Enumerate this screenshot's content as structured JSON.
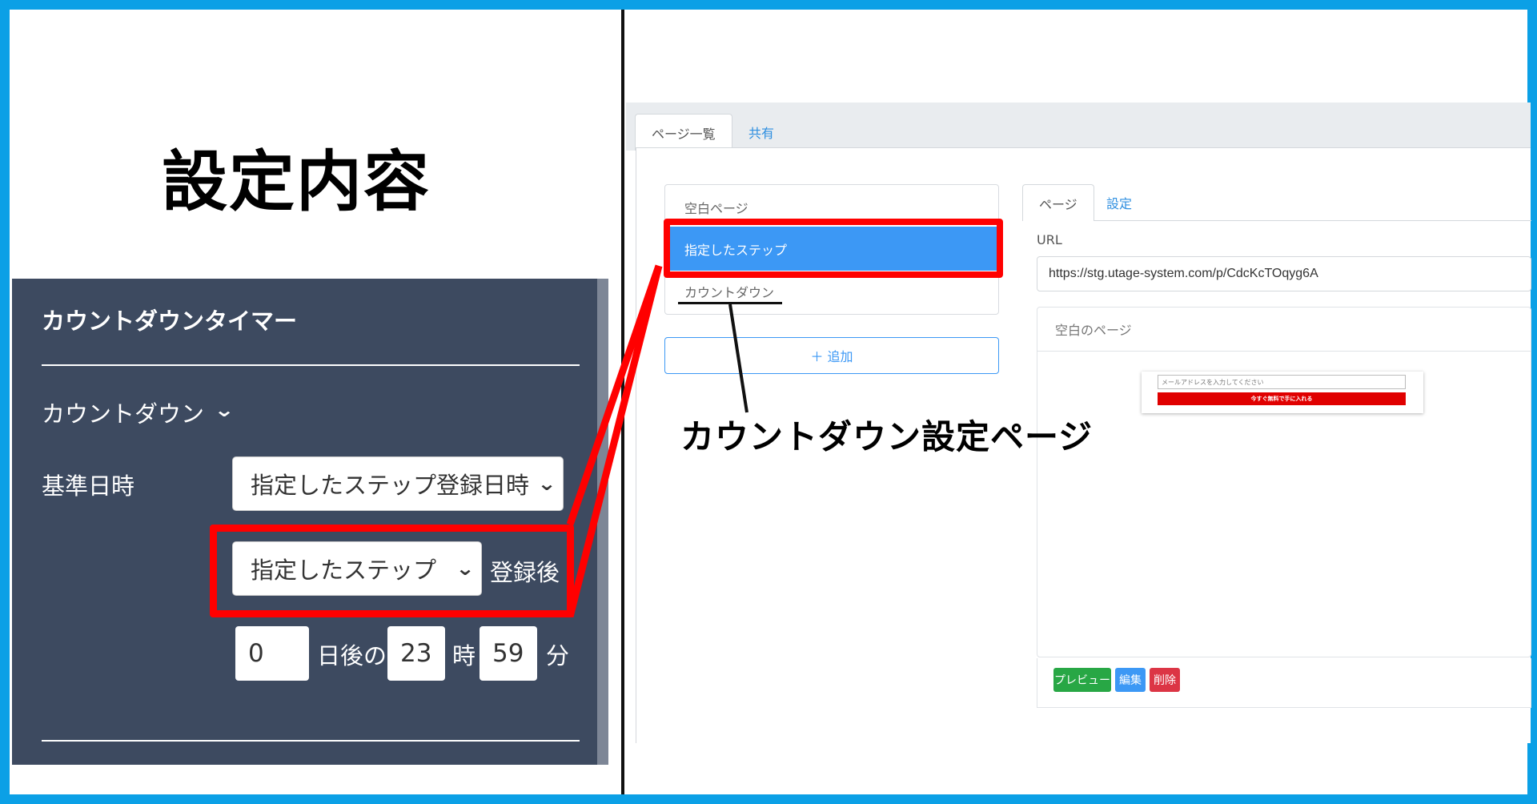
{
  "left": {
    "heading": "設定内容",
    "panel_title": "カウントダウンタイマー",
    "countdown_label": "カウントダウン",
    "base_datetime_label": "基準日時",
    "base_select_value": "指定したステップ登録日時",
    "step_select_value": "指定したステップ",
    "after_registration": "登録後",
    "days_value": "0",
    "days_suffix": "日後の",
    "hours_value": "23",
    "hours_suffix": "時",
    "minutes_value": "59",
    "minutes_suffix": "分"
  },
  "app": {
    "top_tabs": [
      "ページ一覧",
      "共有"
    ],
    "page_list": [
      "空白ページ",
      "指定したステップ",
      "カウントダウン"
    ],
    "add_button": "＋ 追加",
    "page_tabs": [
      "ページ",
      "設定"
    ],
    "url_label": "URL",
    "url_value": "https://stg.utage-system.com/p/CdcKcTOqyg6A",
    "preview_title": "空白のページ",
    "mini_input_placeholder": "メールアドレスを入力してください",
    "mini_button": "今すぐ無料で手に入れる",
    "buttons": {
      "preview": "プレビュー",
      "edit": "編集",
      "delete": "削除"
    }
  },
  "annotation": "カウントダウン設定ページ",
  "colors": {
    "frame": "#0ba0e6",
    "highlight": "#ff0000",
    "panel_bg": "#3d4a60",
    "accent": "#3c98f5"
  }
}
